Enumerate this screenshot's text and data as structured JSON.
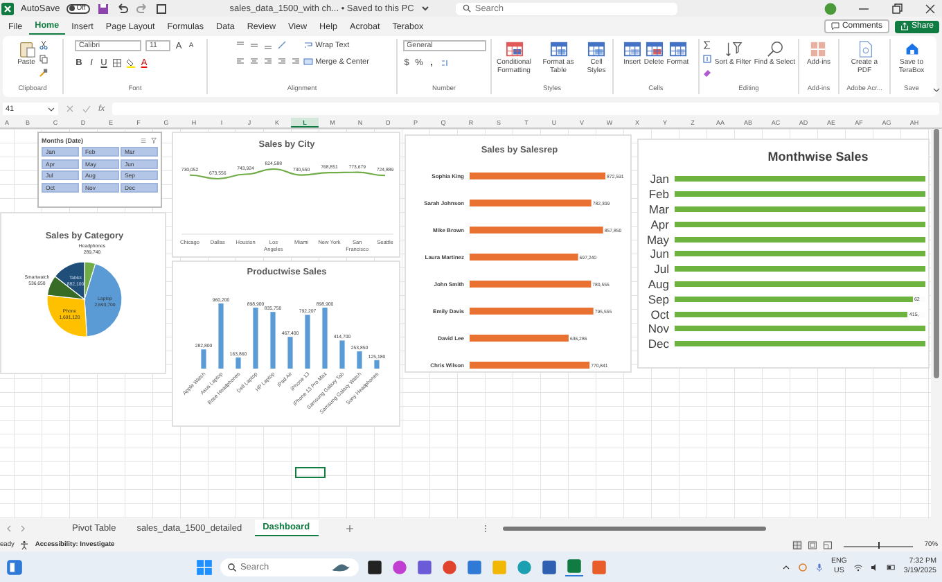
{
  "title_bar": {
    "autosave_label": "AutoSave",
    "autosave_state": "Off",
    "autosave_on": false,
    "document_title": "sales_data_1500_with ch... • Saved to this PC",
    "search": {
      "placeholder": "Search"
    }
  },
  "menu_tabs": [
    {
      "label": "File",
      "selected": false
    },
    {
      "label": "Home",
      "selected": true
    },
    {
      "label": "Insert",
      "selected": false
    },
    {
      "label": "Page Layout",
      "selected": false
    },
    {
      "label": "Formulas",
      "selected": false
    },
    {
      "label": "Data",
      "selected": false
    },
    {
      "label": "Review",
      "selected": false
    },
    {
      "label": "View",
      "selected": false
    },
    {
      "label": "Help",
      "selected": false
    },
    {
      "label": "Acrobat",
      "selected": false
    },
    {
      "label": "Terabox",
      "selected": false
    }
  ],
  "comments_button": "Comments",
  "share_button": "Share",
  "ribbon": {
    "clipboard": {
      "label": "Clipboard",
      "paste": "Paste"
    },
    "font": {
      "label": "Font",
      "font_name": "Calibri",
      "font_size": "11",
      "grow": "A",
      "shrink": "A",
      "bold": "B",
      "italic": "I",
      "underline": "U",
      "font_color": "A"
    },
    "alignment": {
      "label": "Alignment",
      "wrap_text": "Wrap Text",
      "merge_center": "Merge & Center"
    },
    "number": {
      "label": "Number",
      "format": "General",
      "currency": "$",
      "percent": "%",
      "comma": ","
    },
    "styles": {
      "label": "Styles",
      "buttons": [
        "Conditional Formatting",
        "Format as Table",
        "Cell Styles"
      ]
    },
    "cells": {
      "label": "Cells",
      "buttons": [
        "Insert",
        "Delete",
        "Format"
      ]
    },
    "editing": {
      "label": "Editing",
      "buttons": [
        "Sort & Filter",
        "Find & Select"
      ]
    },
    "addins": {
      "label": "Add-ins",
      "buttons": [
        "Add-ins"
      ]
    },
    "adobe": {
      "label": "Adobe Acr...",
      "buttons": [
        "Create a PDF"
      ]
    },
    "save": {
      "label": "Save",
      "buttons": [
        "Save to TeraBox"
      ]
    }
  },
  "formula_bar": {
    "name_box": "41",
    "function_label": "fx"
  },
  "columns": [
    {
      "label": "A",
      "selected": false
    },
    {
      "label": "B",
      "selected": false
    },
    {
      "label": "C",
      "selected": false
    },
    {
      "label": "D",
      "selected": false
    },
    {
      "label": "E",
      "selected": false
    },
    {
      "label": "F",
      "selected": false
    },
    {
      "label": "G",
      "selected": false
    },
    {
      "label": "H",
      "selected": false
    },
    {
      "label": "I",
      "selected": false
    },
    {
      "label": "J",
      "selected": false
    },
    {
      "label": "K",
      "selected": false
    },
    {
      "label": "L",
      "selected": true
    },
    {
      "label": "M",
      "selected": false
    },
    {
      "label": "N",
      "selected": false
    },
    {
      "label": "O",
      "selected": false
    },
    {
      "label": "P",
      "selected": false
    },
    {
      "label": "Q",
      "selected": false
    },
    {
      "label": "R",
      "selected": false
    },
    {
      "label": "S",
      "selected": false
    },
    {
      "label": "T",
      "selected": false
    },
    {
      "label": "U",
      "selected": false
    },
    {
      "label": "V",
      "selected": false
    },
    {
      "label": "W",
      "selected": false
    },
    {
      "label": "X",
      "selected": false
    },
    {
      "label": "Y",
      "selected": false
    },
    {
      "label": "Z",
      "selected": false
    },
    {
      "label": "AA",
      "selected": false
    },
    {
      "label": "AB",
      "selected": false
    },
    {
      "label": "AC",
      "selected": false
    },
    {
      "label": "AD",
      "selected": false
    },
    {
      "label": "AE",
      "selected": false
    },
    {
      "label": "AF",
      "selected": false
    },
    {
      "label": "AG",
      "selected": false
    },
    {
      "label": "AH",
      "selected": false
    }
  ],
  "dashboard": {
    "slicer": {
      "title": "Months (Date)",
      "items": [
        {
          "label": "Jan",
          "selected": true
        },
        {
          "label": "Feb",
          "selected": true
        },
        {
          "label": "Mar",
          "selected": true
        },
        {
          "label": "Apr",
          "selected": true
        },
        {
          "label": "May",
          "selected": true
        },
        {
          "label": "Jun",
          "selected": true
        },
        {
          "label": "Jul",
          "selected": true
        },
        {
          "label": "Aug",
          "selected": true
        },
        {
          "label": "Sep",
          "selected": true
        },
        {
          "label": "Oct",
          "selected": true
        },
        {
          "label": "Nov",
          "selected": true
        },
        {
          "label": "Dec",
          "selected": true
        }
      ]
    },
    "sales_by_category": {
      "chart_data": {
        "type": "pie",
        "title": "Sales by Category",
        "categories": [
          "Headphones",
          "Laptop",
          "Phone",
          "Smartwatch",
          "Tablet"
        ],
        "values": [
          289740,
          2693700,
          1691120,
          536650,
          882100
        ],
        "value_labels": [
          "289,740",
          "2,693,700",
          "1,691,120",
          "536,650",
          "882,100"
        ]
      }
    },
    "sales_by_city": {
      "chart_data": {
        "type": "line",
        "title": "Sales by City",
        "categories": [
          "Chicago",
          "Dallas",
          "Houston",
          "Los Angeles",
          "Miami",
          "New York",
          "San Francisco",
          "Seattle"
        ],
        "series": [
          {
            "color": "#70ad47",
            "values": [
              730052,
              673556,
              743924,
              824588,
              730550,
              768851,
              773679,
              724889
            ],
            "value_labels": [
              "730,052",
              "673,556",
              "743,924",
              "824,588",
              "730,550",
              "768,851",
              "773,679",
              "724,889"
            ]
          }
        ]
      }
    },
    "productwise_sales": {
      "chart_data": {
        "type": "bar",
        "title": "Productwise Sales",
        "categories": [
          "Apple Watch",
          "Asus Laptop",
          "Bose Headphones",
          "Dell Laptop",
          "HP Laptop",
          "iPad Air",
          "iPhone 13",
          "iPhone 13 Pro Max",
          "Samsung Galaxy Tab",
          "Samsung Galaxy Watch",
          "Sony Headphones"
        ],
        "series": [
          {
            "color": "#5b9bd5",
            "values": [
              282800,
              960200,
              163860,
              898900,
              835750,
              467400,
              792207,
              898900,
              414700,
              253850,
              125180
            ],
            "value_labels": [
              "282,800",
              "960,200",
              "163,860",
              "898,900",
              "835,750",
              "467,400",
              "792,207",
              "898,900",
              "414,700",
              "253,850",
              "125,180"
            ]
          }
        ]
      }
    },
    "sales_by_salesrep": {
      "chart_data": {
        "type": "bar",
        "orientation": "horizontal",
        "title": "Sales by Salesrep",
        "categories": [
          "Sophia King",
          "Sarah Johnson",
          "Mike Brown",
          "Laura Martinez",
          "John Smith",
          "Emily Davis",
          "David Lee",
          "Chris Wilson"
        ],
        "series": [
          {
            "color": "#e97132",
            "values": [
              872591,
              782309,
              857850,
              697240,
              780555,
              795555,
              636286,
              770841
            ],
            "value_labels": [
              "872,591",
              "782,309",
              "857,850",
              "697,240",
              "780,555",
              "795,555",
              "636,286",
              "770,841"
            ]
          }
        ]
      }
    },
    "monthwise_sales": {
      "title": "Monthwise Sales",
      "rows": [
        {
          "month": "Jan",
          "level": 1
        },
        {
          "month": "Feb",
          "level": 1
        },
        {
          "month": "Mar",
          "level": 1
        },
        {
          "month": "Apr",
          "level": 1
        },
        {
          "month": "May",
          "level": 1
        },
        {
          "month": "Jun",
          "level": 1
        },
        {
          "month": "Jul",
          "level": 1
        },
        {
          "month": "Aug",
          "level": 1
        },
        {
          "month": "Sep",
          "level": 0.95,
          "value_label": "62"
        },
        {
          "month": "Oct",
          "level": 0.93,
          "value_label": "415,"
        },
        {
          "month": "Nov",
          "level": 1
        },
        {
          "month": "Dec",
          "level": 1
        }
      ]
    }
  },
  "sheet_tabs": [
    {
      "label": "Pivot Table",
      "selected": false
    },
    {
      "label": "sales_data_1500_detailed",
      "selected": false
    },
    {
      "label": "Dashboard",
      "selected": true
    }
  ],
  "status_bar": {
    "status": "eady",
    "accessibility": "Accessibility: Investigate",
    "zoom_slider": {
      "level": 0.5
    },
    "zoom": "70%"
  },
  "taskbar": {
    "search": {
      "placeholder": "Search"
    },
    "language": "ENG",
    "region": "US",
    "time": "7:32 PM",
    "date": "3/19/2025"
  }
}
